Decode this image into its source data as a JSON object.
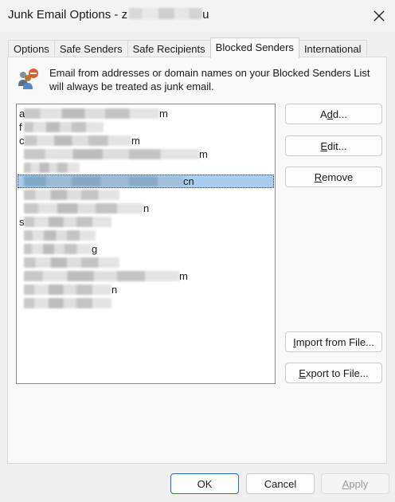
{
  "window": {
    "title_prefix": "Junk Email Options - ",
    "title_fragment": "z",
    "title_suffix": "u"
  },
  "tabs": [
    {
      "label": "Options"
    },
    {
      "label": "Safe Senders"
    },
    {
      "label": "Safe Recipients"
    },
    {
      "label": "Blocked Senders"
    },
    {
      "label": "International"
    }
  ],
  "info": {
    "text": "Email from addresses or domain names on your Blocked Senders List will always be treated as junk email."
  },
  "list": {
    "rows": [
      {
        "visible_text": "a",
        "tail": "m"
      },
      {
        "visible_text": "f",
        "tail": ""
      },
      {
        "visible_text": "c",
        "tail": "m"
      },
      {
        "visible_text": "",
        "tail": "m"
      },
      {
        "visible_text": "",
        "tail": ""
      },
      {
        "visible_text": "",
        "tail": "cn"
      },
      {
        "visible_text": "",
        "tail": ""
      },
      {
        "visible_text": "",
        "tail": "n"
      },
      {
        "visible_text": "s",
        "tail": ""
      },
      {
        "visible_text": "",
        "tail": ""
      },
      {
        "visible_text": "",
        "tail": "g"
      },
      {
        "visible_text": "",
        "tail": ""
      },
      {
        "visible_text": "",
        "tail": "m"
      },
      {
        "visible_text": "",
        "tail": "n"
      },
      {
        "visible_text": "",
        "tail": ""
      }
    ],
    "selected_index": 5
  },
  "buttons": {
    "add": {
      "pre": "A",
      "u": "d",
      "post": "d..."
    },
    "edit": {
      "pre": "",
      "u": "E",
      "post": "dit..."
    },
    "remove": {
      "pre": "",
      "u": "R",
      "post": "emove"
    },
    "import": {
      "pre": "",
      "u": "I",
      "post": "mport from File..."
    },
    "export": {
      "pre": "",
      "u": "E",
      "post": "xport to File..."
    }
  },
  "footer": {
    "ok": "OK",
    "cancel": "Cancel",
    "apply_u": "A",
    "apply_post": "pply"
  }
}
